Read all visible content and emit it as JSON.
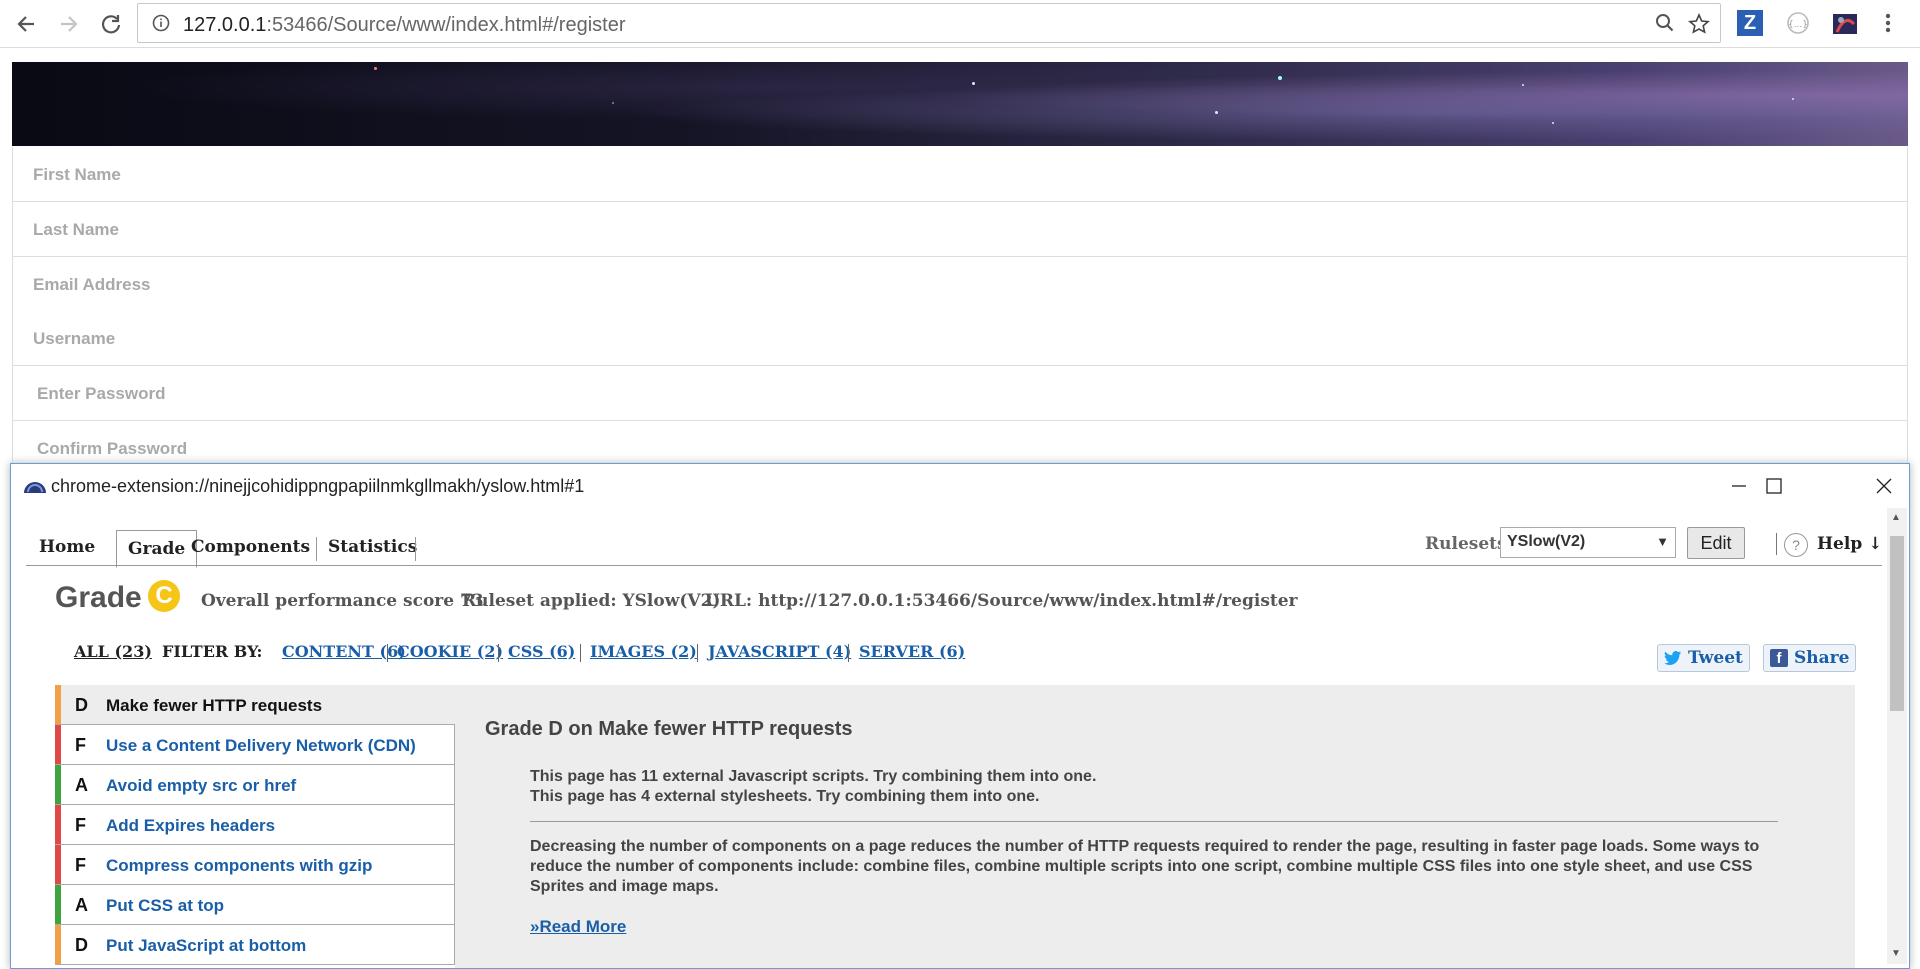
{
  "browser": {
    "url_host": "127.0.0.1",
    "url_rest": ":53466/Source/www/index.html#/register"
  },
  "form": {
    "fields": [
      "First Name",
      "Last Name",
      "Email Address",
      "Username",
      "Enter Password",
      "Confirm Password"
    ]
  },
  "popup": {
    "title": "chrome-extension://ninejjcohidippngpapiilnmkgllmakh/yslow.html#1",
    "tabs": [
      "Home",
      "Grade",
      "Components",
      "Statistics"
    ],
    "active_tab": "Grade",
    "rulesets_label": "Rulesets",
    "ruleset_value": "YSlow(V2)",
    "edit_label": "Edit",
    "help_q": "?",
    "help_label": "Help ↓",
    "grade_label": "Grade",
    "grade": "C",
    "score_text": "Overall performance score 73",
    "ruleset_text": "Ruleset applied: YSlow(V2)",
    "url_text": "URL: http://127.0.0.1:53466/Source/www/index.html#/register",
    "filter": {
      "all": "ALL (23)",
      "label": "FILTER BY:",
      "items": [
        "CONTENT (6)",
        "COOKIE (2)",
        "CSS (6)",
        "IMAGES (2)",
        "JAVASCRIPT (4)",
        "SERVER (6)"
      ]
    },
    "tweet": "Tweet",
    "share": "Share",
    "rules": [
      {
        "grade": "D",
        "title": "Make fewer HTTP requests"
      },
      {
        "grade": "F",
        "title": "Use a Content Delivery Network (CDN)"
      },
      {
        "grade": "A",
        "title": "Avoid empty src or href"
      },
      {
        "grade": "F",
        "title": "Add Expires headers"
      },
      {
        "grade": "F",
        "title": "Compress components with gzip"
      },
      {
        "grade": "A",
        "title": "Put CSS at top"
      },
      {
        "grade": "D",
        "title": "Put JavaScript at bottom"
      }
    ],
    "grade_colors": {
      "A": "#3fa33f",
      "D": "#f0a048",
      "F": "#e04848"
    },
    "detail": {
      "heading": "Grade D on Make fewer HTTP requests",
      "line1": "This page has 11 external Javascript scripts. Try combining them into one.",
      "line2": "This page has 4 external stylesheets. Try combining them into one.",
      "body": "Decreasing the number of components on a page reduces the number of HTTP requests required to render the page, resulting in faster page loads. Some ways to reduce the number of components include: combine files, combine multiple scripts into one script, combine multiple CSS files into one style sheet, and use CSS Sprites and image maps.",
      "read_more": "»Read More"
    }
  }
}
